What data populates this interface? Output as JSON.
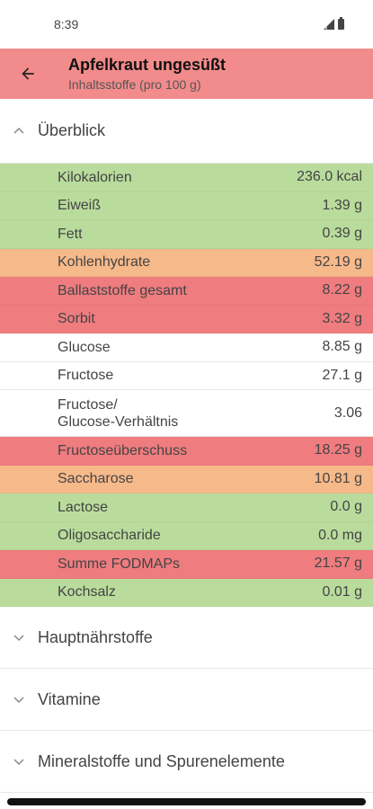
{
  "status_bar": {
    "time": "8:39"
  },
  "app_bar": {
    "title": "Apfelkraut ungesüßt",
    "subtitle": "Inhaltsstoffe (pro 100 g)",
    "color": "#f28b8b"
  },
  "overview": {
    "title": "Überblick",
    "expanded": true,
    "rows": [
      {
        "label": "Kilokalorien",
        "value": "236.0 kcal",
        "status": "green"
      },
      {
        "label": "Eiweiß",
        "value": "1.39 g",
        "status": "green"
      },
      {
        "label": "Fett",
        "value": "0.39 g",
        "status": "green"
      },
      {
        "label": "Kohlenhydrate",
        "value": "52.19 g",
        "status": "orange"
      },
      {
        "label": "Ballaststoffe gesamt",
        "value": "8.22 g",
        "status": "red"
      },
      {
        "label": "Sorbit",
        "value": "3.32 g",
        "status": "red"
      },
      {
        "label": "Glucose",
        "value": "8.85 g",
        "status": "white"
      },
      {
        "label": "Fructose",
        "value": "27.1 g",
        "status": "white"
      },
      {
        "label": "Fructose/\nGlucose-Verhältnis",
        "value": "3.06",
        "status": "white"
      },
      {
        "label": "Fructoseüberschuss",
        "value": "18.25 g",
        "status": "red"
      },
      {
        "label": "Saccharose",
        "value": "10.81 g",
        "status": "orange"
      },
      {
        "label": "Lactose",
        "value": "0.0 g",
        "status": "green"
      },
      {
        "label": "Oligosaccharide",
        "value": "0.0 mg",
        "status": "green"
      },
      {
        "label": "Summe FODMAPs",
        "value": "21.57 g",
        "status": "red"
      },
      {
        "label": "Kochsalz",
        "value": "0.01 g",
        "status": "green"
      }
    ]
  },
  "collapsed_sections": [
    {
      "title": "Hauptnährstoffe"
    },
    {
      "title": "Vitamine"
    },
    {
      "title": "Mineralstoffe und Spurenelemente"
    }
  ],
  "colors": {
    "green": "#b9dc9c",
    "orange": "#f6b98a",
    "red": "#ef7c7f"
  }
}
